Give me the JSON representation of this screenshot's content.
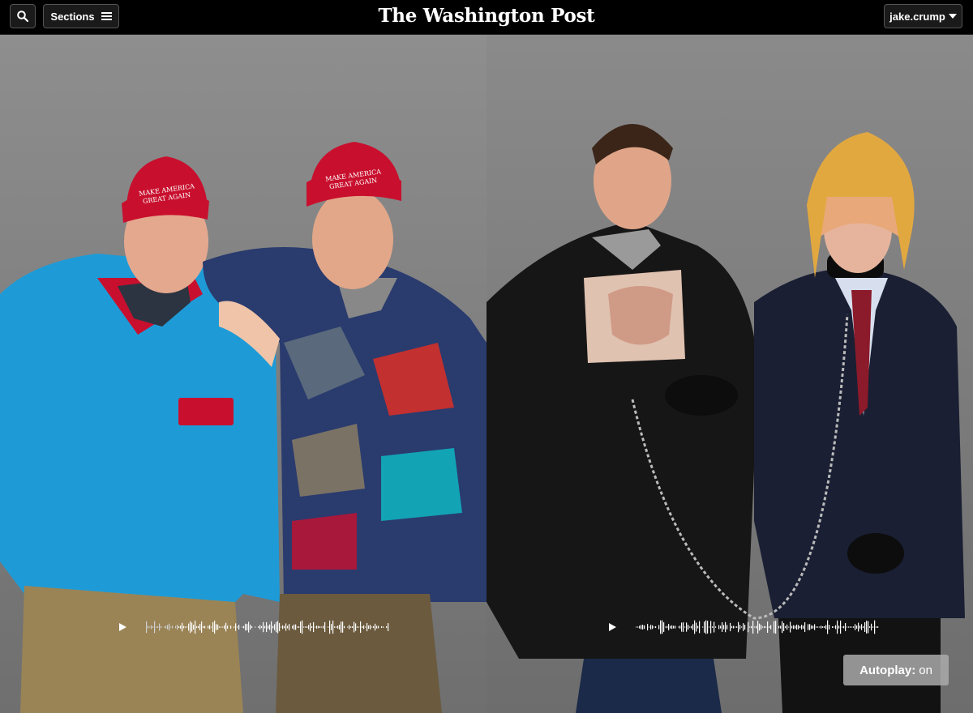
{
  "header": {
    "logo_text": "The Washington Post",
    "sections_label": "Sections",
    "user_label": "jake.crump",
    "search_icon": "search-icon",
    "menu_icon": "hamburger-menu-icon",
    "dropdown_icon": "caret-down-icon"
  },
  "photos": {
    "left": {
      "hat_text_line1": "MAKE AMERICA",
      "hat_text_line2": "GREAT AGAIN"
    },
    "right": {}
  },
  "audio": {
    "left": {
      "play_icon": "play-icon"
    },
    "right": {
      "play_icon": "play-icon"
    }
  },
  "autoplay": {
    "label": "Autoplay:",
    "state": "on"
  },
  "colors": {
    "topbar": "#000000",
    "maga_red": "#c8102e",
    "fleece_blue": "#1e9bd7",
    "autoplay_bg": "#aaaaaa"
  }
}
